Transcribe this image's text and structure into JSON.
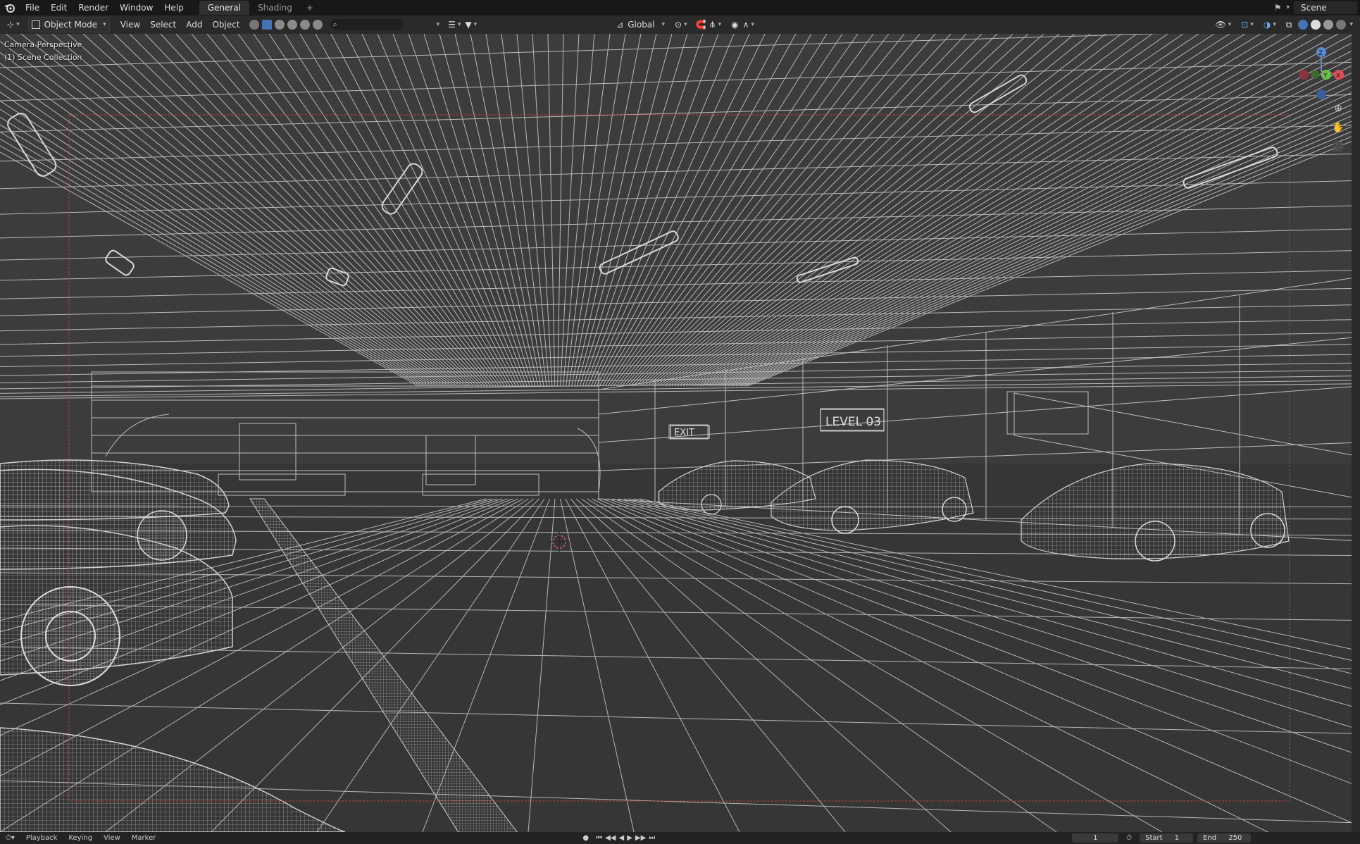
{
  "menubar": {
    "items": [
      "File",
      "Edit",
      "Render",
      "Window",
      "Help"
    ],
    "workspace_tabs": [
      "General",
      "Shading"
    ],
    "active_tab": "General",
    "add_tab_label": "+",
    "scene_name": "Scene"
  },
  "viewport_header": {
    "mode_label": "Object Mode",
    "menus": [
      "View",
      "Select",
      "Add",
      "Object"
    ],
    "orientation_label": "Global"
  },
  "viewport": {
    "perspective_label": "Camera Perspective",
    "collection_label": "(1) Scene Collection",
    "gizmo_axes": {
      "z": "Z",
      "y": "Y",
      "x": "X"
    },
    "scene_signs": {
      "exit": "EXIT",
      "level": "LEVEL 03"
    },
    "colors": {
      "background": "#3a3a3a",
      "wire": "#c9c9c9",
      "camera_frame": "#b4453a"
    }
  },
  "timeline": {
    "menus": [
      "Playback",
      "Keying",
      "View",
      "Marker"
    ],
    "current_frame": "1",
    "start_label": "Start",
    "start_value": "1",
    "end_label": "End",
    "end_value": "250"
  },
  "icons": [
    "blender-logo-icon",
    "editor-type-icon",
    "select-box-icon",
    "search-icon",
    "filter-icon",
    "transform-pivot-icon",
    "snap-icon",
    "proportional-edit-icon",
    "visibility-icon",
    "gizmo-icon",
    "overlay-icon",
    "xray-icon",
    "shading-wireframe-icon",
    "shading-solid-icon",
    "shading-material-icon",
    "shading-rendered-icon",
    "zoom-icon",
    "pan-hand-icon",
    "camera-view-icon",
    "record-icon",
    "play-icon"
  ]
}
